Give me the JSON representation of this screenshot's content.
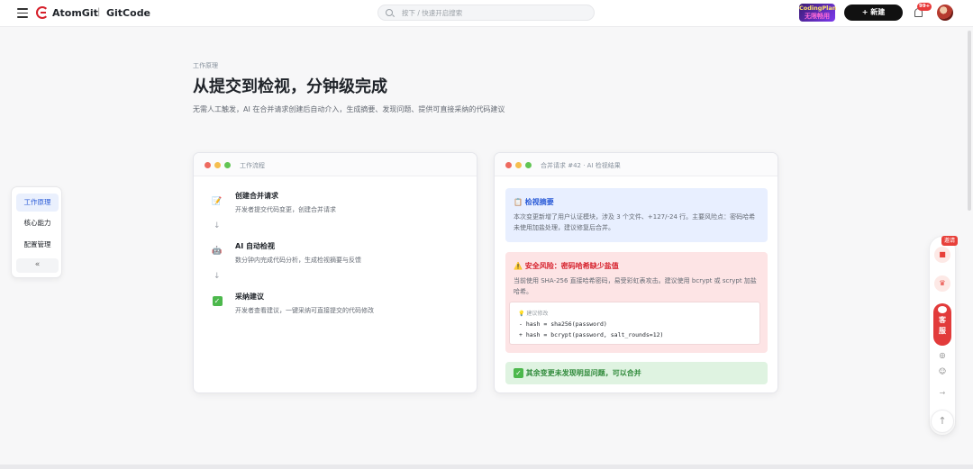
{
  "header": {
    "brand_primary": "AtomGit",
    "brand_separator": "|",
    "brand_secondary": "GitCode",
    "search_placeholder": "按下 / 快速开启搜索",
    "promo_line1": "CodingPlan",
    "promo_line2": "无限畅用",
    "new_button_label": "+ 新建",
    "notification_count": "99+"
  },
  "hero": {
    "eyebrow": "工作原理",
    "title": "从提交到检视，分钟级完成",
    "description": "无需人工触发，AI 在合并请求创建后自动介入，生成摘要、发现问题、提供可直接采纳的代码建议"
  },
  "side_nav": {
    "items": [
      {
        "label": "工作原理",
        "active": true
      },
      {
        "label": "核心能力",
        "active": false
      },
      {
        "label": "配置管理",
        "active": false
      }
    ],
    "collapse_label": "«"
  },
  "workflow_card": {
    "title": "工作流程",
    "arrow": "↓",
    "steps": [
      {
        "icon": "memo-icon",
        "emoji": "📝",
        "title": "创建合并请求",
        "desc": "开发者提交代码变更，创建合并请求"
      },
      {
        "icon": "robot-icon",
        "emoji": "🤖",
        "title": "AI 自动检视",
        "desc": "数分钟内完成代码分析，生成检视摘要与反馈"
      },
      {
        "icon": "check-icon",
        "emoji": "✓",
        "title": "采纳建议",
        "desc": "开发者查看建议，一键采纳可直接提交的代码修改"
      }
    ]
  },
  "review_card": {
    "title": "合并请求 #42 · AI 检视结果",
    "summary": {
      "icon": "📋",
      "title": "检视摘要",
      "text": "本次变更新增了用户认证模块，涉及 3 个文件、+127/-24 行。主要风险点：密码哈希未使用加盐处理，建议修复后合并。"
    },
    "risk": {
      "icon": "⚠️",
      "title": "安全风险：密码哈希缺少盐值",
      "text": "当前使用 SHA-256 直接哈希密码，易受彩虹表攻击。建议使用 bcrypt 或 scrypt 加盐哈希。",
      "suggestion_label": "💡 建议修改",
      "code_removed": "- hash = sha256(password)",
      "code_added": "+ hash = bcrypt(password, salt_rounds=12)"
    },
    "ok": {
      "icon": "✓",
      "text": "其余变更未发现明显问题，可以合并"
    }
  },
  "floating_bar": {
    "invite_label": "邀请",
    "service_label_1": "客",
    "service_label_2": "服",
    "to_top": "↑",
    "next": "→"
  },
  "colors": {
    "accent_blue": "#2a5bd7",
    "danger": "#d6202b",
    "success": "#4cb84c"
  }
}
